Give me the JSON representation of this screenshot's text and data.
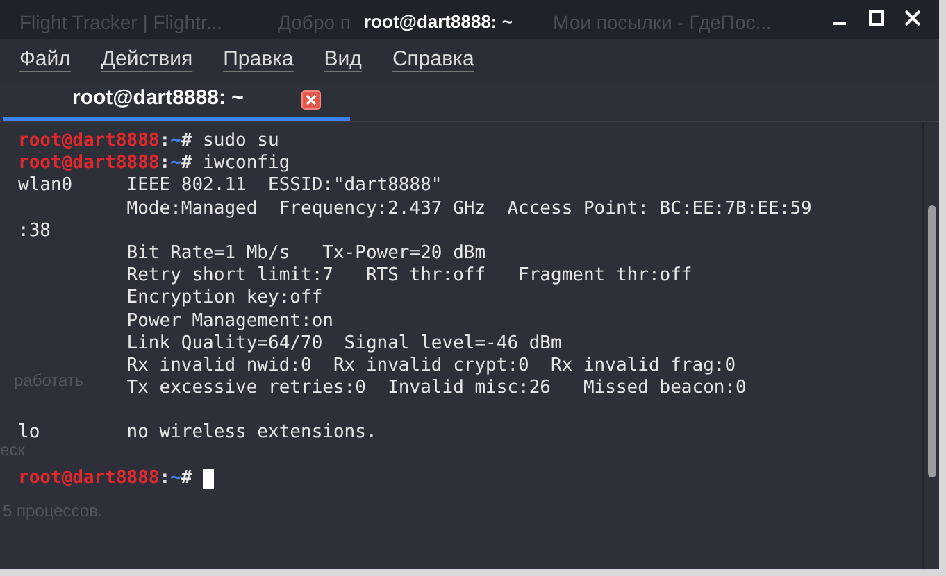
{
  "window": {
    "title": "root@dart8888: ~"
  },
  "background_tabs": [
    {
      "label": "Flight Tracker | Flightr..."
    },
    {
      "label": "Добро п"
    },
    {
      "label": "Мои посылки - ГдеПос..."
    }
  ],
  "menu": [
    "Файл",
    "Действия",
    "Правка",
    "Вид",
    "Справка"
  ],
  "tabs": [
    {
      "label": "root@dart8888: ~",
      "selected": true
    }
  ],
  "background_text": [
    "работать",
    "еск",
    "5 процессов."
  ],
  "lines": [
    {
      "kind": "prompt",
      "user": "root@dart8888",
      "colon": ":",
      "path": "~",
      "symbol": "#",
      "command": "sudo su",
      "cursor": false
    },
    {
      "kind": "prompt",
      "user": "root@dart8888",
      "colon": ":",
      "path": "~",
      "symbol": "#",
      "command": "iwconfig",
      "cursor": false
    },
    {
      "kind": "output",
      "device": "wlan0",
      "text": "IEEE 802.11  ESSID:\"dart8888\""
    },
    {
      "kind": "output",
      "text": "Mode:Managed  Frequency:2.437 GHz  Access Point: BC:EE:7B:EE:59"
    },
    {
      "kind": "wrap",
      "text": ":38"
    },
    {
      "kind": "output",
      "text": "Bit Rate=1 Mb/s   Tx-Power=20 dBm"
    },
    {
      "kind": "output",
      "text": "Retry short limit:7   RTS thr:off   Fragment thr:off"
    },
    {
      "kind": "output",
      "text": "Encryption key:off"
    },
    {
      "kind": "output",
      "text": "Power Management:on"
    },
    {
      "kind": "output",
      "text": "Link Quality=64/70  Signal level=-46 dBm"
    },
    {
      "kind": "output",
      "text": "Rx invalid nwid:0  Rx invalid crypt:0  Rx invalid frag:0"
    },
    {
      "kind": "output",
      "text": "Tx excessive retries:0  Invalid misc:26   Missed beacon:0"
    },
    {
      "kind": "blank"
    },
    {
      "kind": "output",
      "device": "lo",
      "text": "no wireless extensions."
    },
    {
      "kind": "blank"
    },
    {
      "kind": "prompt",
      "user": "root@dart8888",
      "colon": ":",
      "path": "~",
      "symbol": "#",
      "cursor": true
    }
  ]
}
